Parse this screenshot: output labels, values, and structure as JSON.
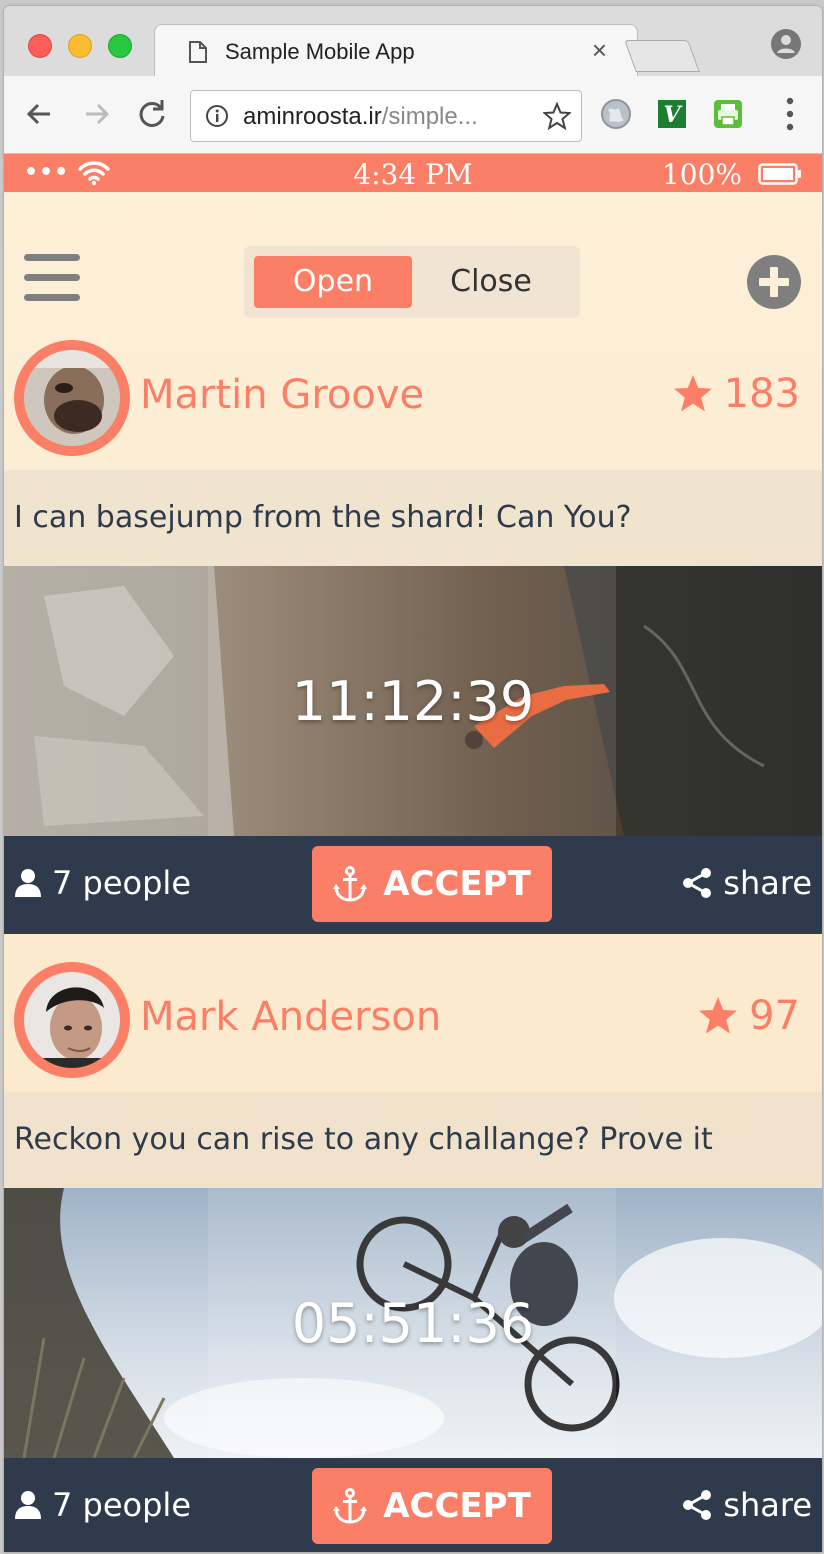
{
  "browser": {
    "tab_title": "Sample Mobile App",
    "tab_close": "×",
    "url_host": "aminroosta.ir",
    "url_path": "/simple..."
  },
  "status_bar": {
    "signal": "•••",
    "time": "4:34 PM",
    "battery": "100%"
  },
  "app": {
    "tabs": [
      {
        "label": "Open",
        "active": true
      },
      {
        "label": "Close",
        "active": false
      }
    ]
  },
  "cards": [
    {
      "user": "Martin Groove",
      "rating": "183",
      "caption": "I can basejump from the shard! Can You?",
      "timer": "11:12:39",
      "people": "7 people",
      "accept": "ACCEPT",
      "share": "share"
    },
    {
      "user": "Mark Anderson",
      "rating": "97",
      "caption": "Reckon you can rise to any challange? Prove it",
      "timer": "05:51:36",
      "people": "7 people",
      "accept": "ACCEPT",
      "share": "share"
    }
  ],
  "colors": {
    "accent": "#fb7f66",
    "footer": "#2f3b4c",
    "background": "#fdf0d8"
  }
}
